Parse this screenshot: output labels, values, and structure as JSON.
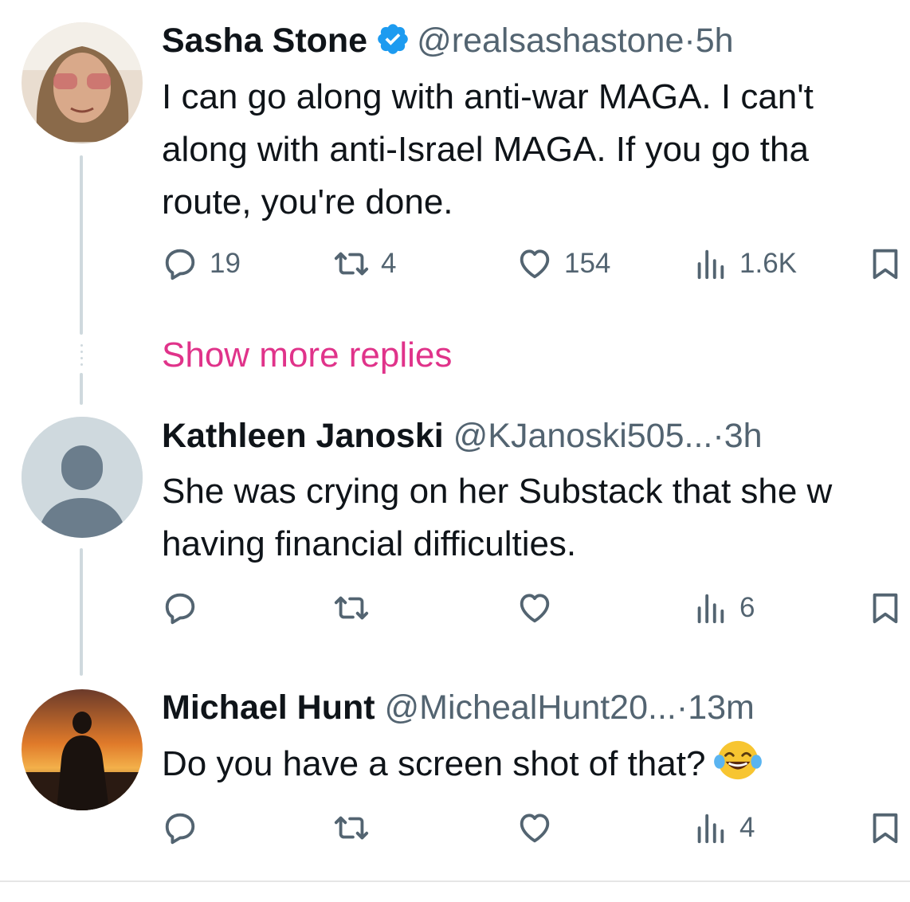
{
  "thread": {
    "show_more_label": "Show more replies"
  },
  "tweets": [
    {
      "name": "Sasha Stone",
      "verified": true,
      "handle": "@realsashastone",
      "separator": "·",
      "time": "5h",
      "text_lines": [
        "I can go along with anti-war MAGA. I can't",
        "along with anti-Israel MAGA. If you go tha",
        "route, you're done."
      ],
      "replies": "19",
      "retweets": "4",
      "likes": "154",
      "views": "1.6K"
    },
    {
      "name": "Kathleen Janoski",
      "verified": false,
      "handle": "@KJanoski505...",
      "separator": "·",
      "time": "3h",
      "text_lines": [
        "She was crying on her Substack that she w",
        "having financial difficulties."
      ],
      "replies": "",
      "retweets": "",
      "likes": "",
      "views": "6"
    },
    {
      "name": "Michael Hunt",
      "verified": false,
      "handle": "@MichealHunt20...",
      "separator": "·",
      "time": "13m",
      "text_lines": [
        "Do you have a screen shot of that?"
      ],
      "emoji": "face-with-tears-of-joy",
      "replies": "",
      "retweets": "",
      "likes": "",
      "views": "4"
    }
  ],
  "colors": {
    "text": "#0f1419",
    "secondary": "#536471",
    "verified": "#1d9bf0",
    "show_more": "#e0338a",
    "thread_line": "#cfd9de"
  },
  "icons": [
    "reply-icon",
    "retweet-icon",
    "like-icon",
    "views-icon",
    "bookmark-icon",
    "verified-icon",
    "default-avatar-icon"
  ]
}
